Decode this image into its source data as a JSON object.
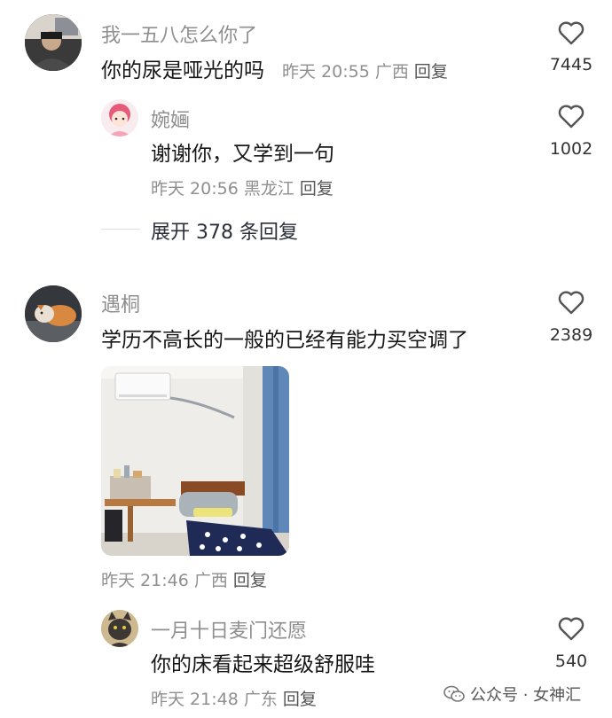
{
  "comments": [
    {
      "username": "我一五八怎么你了",
      "text": "你的尿是哑光的吗",
      "time": "昨天 20:55",
      "location": "广西",
      "reply_label": "回复",
      "likes": "7445"
    },
    {
      "username": "婉婳",
      "text": "谢谢你，又学到一句",
      "time": "昨天 20:56",
      "location": "黑龙江",
      "reply_label": "回复",
      "likes": "1002"
    },
    {
      "username": "遇桐",
      "text": "学历不高长的一般的已经有能力买空调了",
      "time": "昨天 21:46",
      "location": "广西",
      "reply_label": "回复",
      "likes": "2389"
    },
    {
      "username": "一月十日麦门还愿",
      "text": "你的床看起来超级舒服哇",
      "time": "昨天 21:48",
      "location": "广东",
      "reply_label": "回复",
      "likes": "540"
    }
  ],
  "expand_replies": "展开 378 条回复",
  "watermark": "公众号 · 女神汇",
  "icons": {
    "like": "heart-outline-icon",
    "watermark": "wechat-icon"
  },
  "colors": {
    "meta_gray": "#8f8f8f",
    "text": "#161616"
  }
}
